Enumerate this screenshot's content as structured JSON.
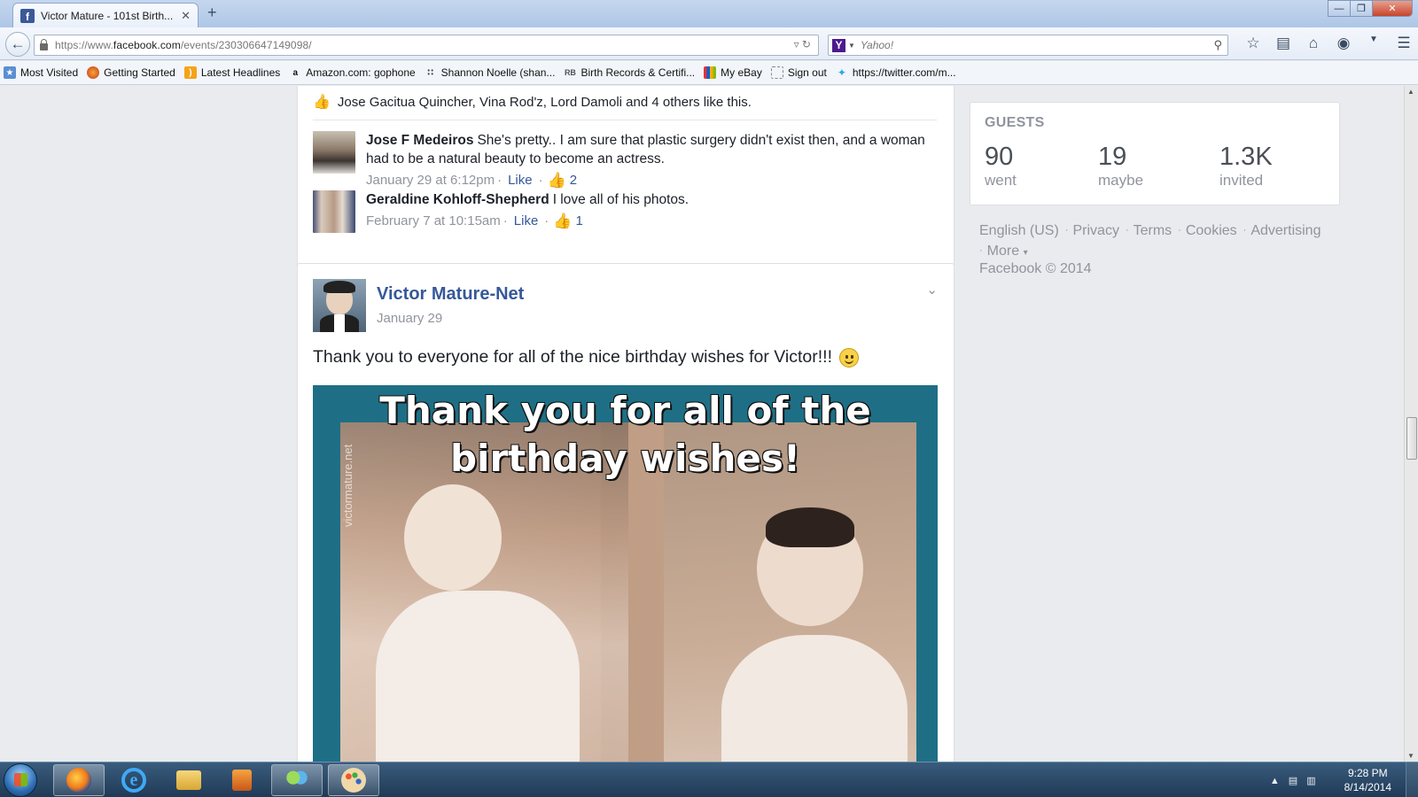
{
  "browser": {
    "tab_title": "Victor Mature - 101st Birth...",
    "tab_close": "✕",
    "new_tab": "+",
    "url_prefix": "https://www.",
    "url_domain": "facebook.com",
    "url_path": "/events/230306647149098/",
    "search_placeholder": "Yahoo!",
    "bookmarks": [
      {
        "label": "Most Visited",
        "icon": "bookmark-star-icon"
      },
      {
        "label": "Getting Started",
        "icon": "firefox-icon"
      },
      {
        "label": "Latest Headlines",
        "icon": "rss-icon"
      },
      {
        "label": "Amazon.com: gophone",
        "icon": "amazon-icon"
      },
      {
        "label": "Shannon Noelle (shan...",
        "icon": "people-icon"
      },
      {
        "label": "Birth Records & Certifi...",
        "icon": "rb-icon"
      },
      {
        "label": "My eBay",
        "icon": "ebay-icon"
      },
      {
        "label": "Sign out",
        "icon": "page-icon"
      },
      {
        "label": "https://twitter.com/m...",
        "icon": "twitter-icon"
      }
    ]
  },
  "comments_card": {
    "likes_text": "Jose Gacitua Quincher, Vina Rod'z, Lord Damoli and 4 others like this.",
    "comments": [
      {
        "author": "Jose F Medeiros",
        "text": "She's pretty.. I am sure that plastic surgery didn't exist then, and a woman had to be a natural beauty to become an actress.",
        "time": "January 29 at 6:12pm",
        "like_label": "Like",
        "like_count": "2"
      },
      {
        "author": "Geraldine Kohloff-Shepherd",
        "text": "I love all of his photos.",
        "time": "February 7 at 10:15am",
        "like_label": "Like",
        "like_count": "1"
      }
    ]
  },
  "post": {
    "author": "Victor Mature-Net",
    "date": "January 29",
    "text": "Thank you to everyone for all of the nice birthday wishes for Victor!!!",
    "image_caption_line1": "Thank you for all of the",
    "image_caption_line2": "birthday wishes!",
    "image_watermark": "victormature.net"
  },
  "guests": {
    "title": "GUESTS",
    "stats": [
      {
        "value": "90",
        "label": "went"
      },
      {
        "value": "19",
        "label": "maybe"
      },
      {
        "value": "1.3K",
        "label": "invited"
      }
    ]
  },
  "footer": {
    "links": [
      "English (US)",
      "Privacy",
      "Terms",
      "Cookies",
      "Advertising"
    ],
    "more_label": "More",
    "copyright": "Facebook © 2014"
  },
  "taskbar": {
    "time": "9:28 PM",
    "date": "8/14/2014"
  },
  "colors": {
    "facebook_blue": "#3b5998",
    "link_blue": "#365899",
    "meta_gray": "#90949c",
    "image_frame_teal": "#1e6f85"
  }
}
